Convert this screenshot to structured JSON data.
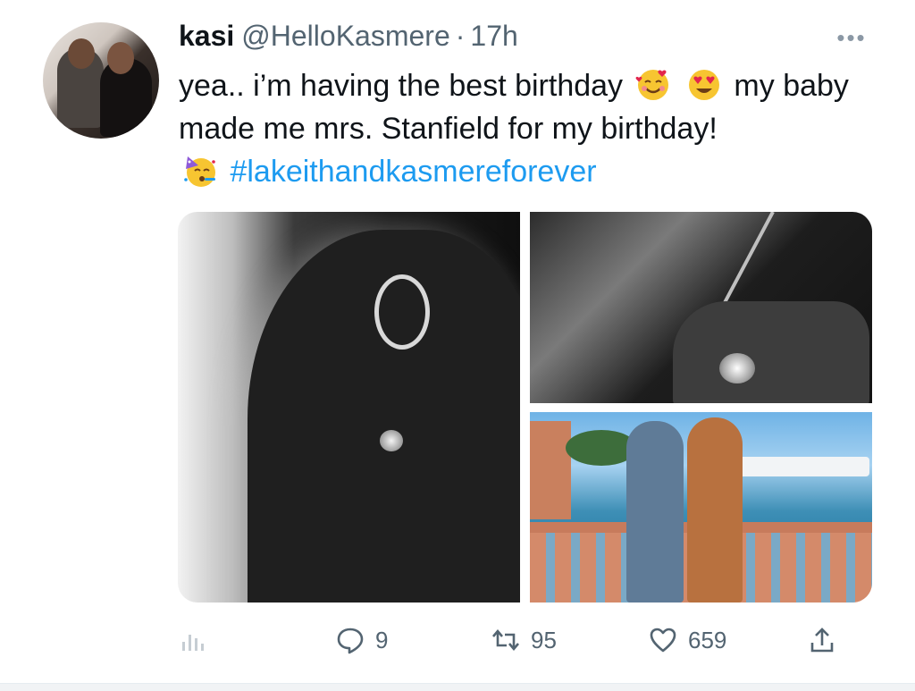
{
  "tweet": {
    "author": {
      "display_name": "kasi",
      "handle": "@HelloKasmere",
      "separator": "·",
      "time": "17h"
    },
    "more_label": "•••",
    "text": {
      "part1": "yea.. i’m having the best birthday",
      "part2": "my baby made me mrs. Stanfield for my birthday!",
      "hashtag": "#lakeithandkasmereforever"
    },
    "emojis": [
      "smiling-face-with-hearts",
      "heart-eyes",
      "partying-face"
    ],
    "media": [
      {
        "description_icon": "photo-profile-with-earring"
      },
      {
        "description_icon": "photo-ring-hand-closeup"
      },
      {
        "description_icon": "photo-couple-by-water"
      }
    ],
    "actions": {
      "analytics_icon": "bar-chart-icon",
      "replies": "9",
      "retweets": "95",
      "likes": "659",
      "share_icon": "share-icon"
    }
  },
  "colors": {
    "text": "#0f1419",
    "secondary": "#536471",
    "link": "#1d9bf0"
  }
}
